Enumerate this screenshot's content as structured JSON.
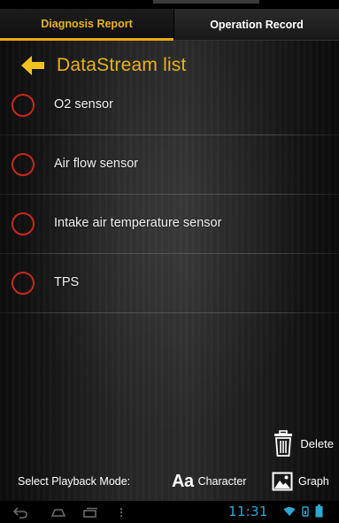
{
  "tabs": [
    {
      "label": "Diagnosis Report",
      "active": true
    },
    {
      "label": "Operation Record",
      "active": false
    }
  ],
  "header": {
    "title": "DataStream list",
    "back_icon": "arrow-left-icon"
  },
  "list": {
    "items": [
      {
        "label": "O2 sensor",
        "selected": false
      },
      {
        "label": "Air flow sensor",
        "selected": false
      },
      {
        "label": "Intake air temperature sensor",
        "selected": false
      },
      {
        "label": "TPS",
        "selected": false
      }
    ]
  },
  "actions": {
    "delete_label": "Delete",
    "delete_icon": "trash-icon"
  },
  "playback": {
    "label": "Select Playback Mode:",
    "character_icon": "Aa",
    "character_label": "Character",
    "graph_label": "Graph"
  },
  "system_bar": {
    "time": "11:31",
    "icons": [
      "back-icon",
      "home-icon",
      "recent-apps-icon",
      "menu-icon",
      "wifi-icon",
      "signal-icon",
      "battery-icon"
    ]
  },
  "colors": {
    "accent": "#e8b21d",
    "radio": "#c8281c",
    "clock": "#2fa7cf",
    "text": "#f0f0f0"
  }
}
